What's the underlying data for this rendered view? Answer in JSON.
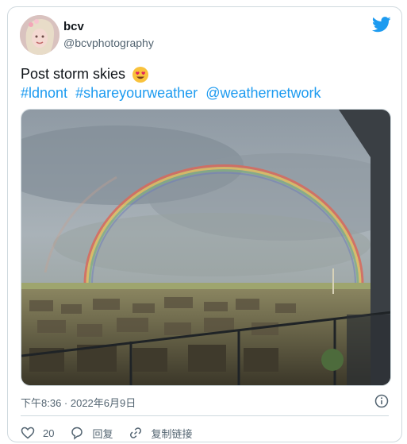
{
  "author": {
    "name": "bcv",
    "handle": "@bcvphotography"
  },
  "tweet": {
    "text": "Post storm skies",
    "hashtags": [
      "#ldnont",
      "#shareyourweather",
      "@weathernetwork"
    ]
  },
  "meta": {
    "timestamp": "下午8:36 · 2022年6月9日"
  },
  "actions": {
    "like_count": "20",
    "reply_label": "回复",
    "copy_link_label": "复制链接"
  },
  "icons": {
    "logo": "twitter-bird-icon",
    "emoji": "heart-eyes-emoji-icon",
    "info": "info-icon",
    "like": "heart-icon",
    "reply": "reply-bubble-icon",
    "link": "link-icon"
  },
  "colors": {
    "brand": "#1d9bf0",
    "text": "#0f1419",
    "muted": "#536471",
    "border": "#cfd9de"
  }
}
